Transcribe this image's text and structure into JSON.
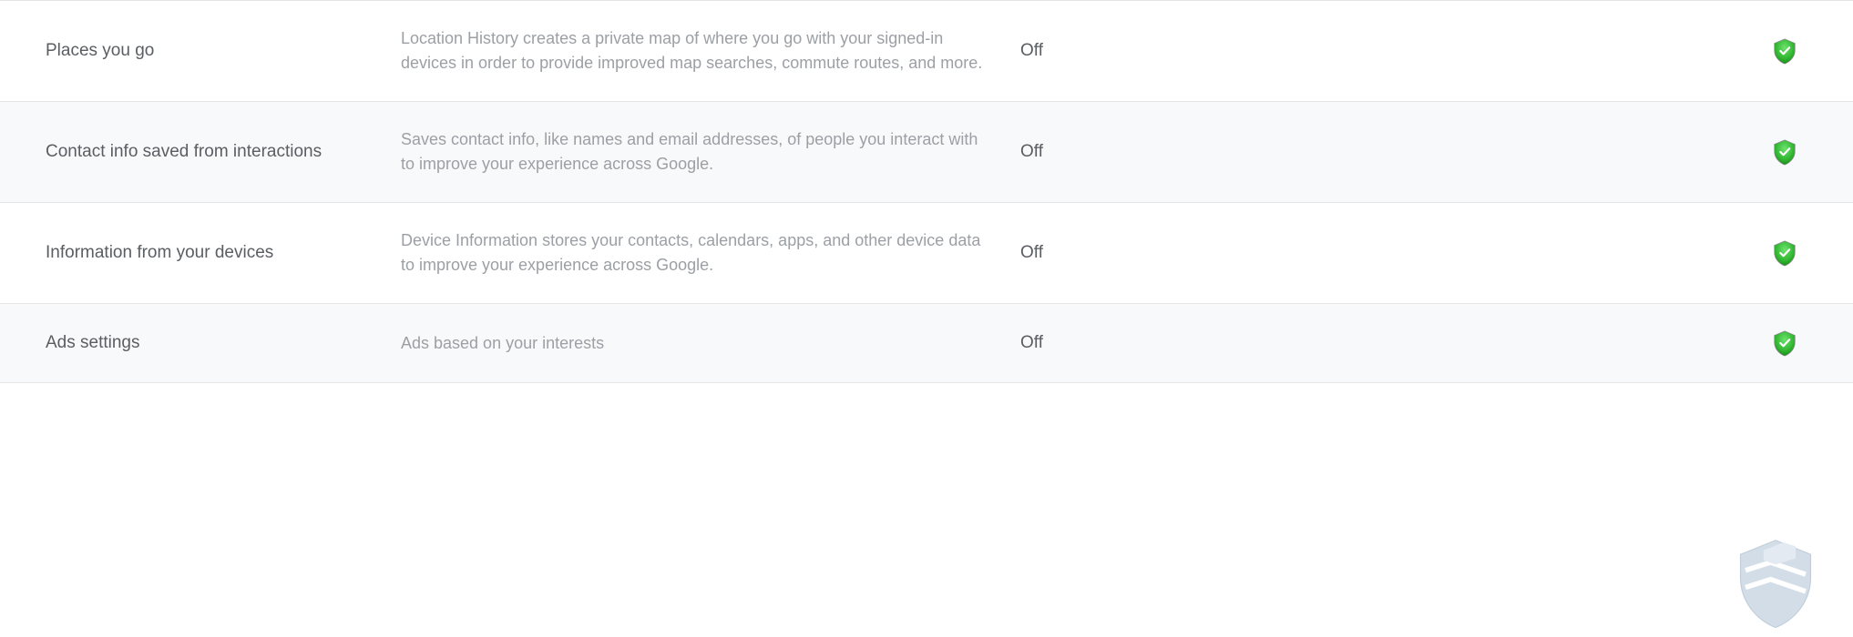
{
  "rows": [
    {
      "title": "Places you go",
      "description": "Location History creates a private map of where you go with your signed-in devices in order to provide improved map searches, commute routes, and more.",
      "status": "Off"
    },
    {
      "title": "Contact info saved from interactions",
      "description": "Saves contact info, like names and email addresses, of people you interact with to improve your experience across Google.",
      "status": "Off"
    },
    {
      "title": "Information from your devices",
      "description": "Device Information stores your contacts, calendars, apps, and other device data to improve your experience across Google.",
      "status": "Off"
    },
    {
      "title": "Ads settings",
      "description": "Ads based on your interests",
      "status": "Off"
    }
  ]
}
